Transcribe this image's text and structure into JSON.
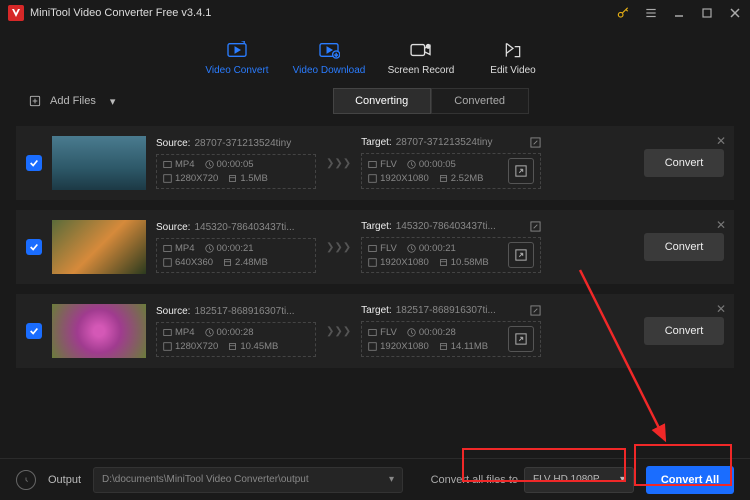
{
  "app": {
    "title": "MiniTool Video Converter Free v3.4.1"
  },
  "tabs": [
    {
      "label": "Video Convert"
    },
    {
      "label": "Video Download"
    },
    {
      "label": "Screen Record"
    },
    {
      "label": "Edit Video"
    }
  ],
  "addFiles": "Add Files",
  "subtabs": {
    "converting": "Converting",
    "converted": "Converted"
  },
  "labels": {
    "source": "Source:",
    "target": "Target:",
    "convert": "Convert"
  },
  "items": [
    {
      "source": {
        "name": "28707-371213524tiny",
        "fmt": "MP4",
        "dur": "00:00:05",
        "res": "1280X720",
        "size": "1.5MB"
      },
      "target": {
        "name": "28707-371213524tiny",
        "fmt": "FLV",
        "dur": "00:00:05",
        "res": "1920X1080",
        "size": "2.52MB"
      }
    },
    {
      "source": {
        "name": "145320-786403437ti...",
        "fmt": "MP4",
        "dur": "00:00:21",
        "res": "640X360",
        "size": "2.48MB"
      },
      "target": {
        "name": "145320-786403437ti...",
        "fmt": "FLV",
        "dur": "00:00:21",
        "res": "1920X1080",
        "size": "10.58MB"
      }
    },
    {
      "source": {
        "name": "182517-868916307ti...",
        "fmt": "MP4",
        "dur": "00:00:28",
        "res": "1280X720",
        "size": "10.45MB"
      },
      "target": {
        "name": "182517-868916307ti...",
        "fmt": "FLV",
        "dur": "00:00:28",
        "res": "1920X1080",
        "size": "14.11MB"
      }
    }
  ],
  "footer": {
    "output": "Output",
    "path": "D:\\documents\\MiniTool Video Converter\\output",
    "convertAllTo": "Convert all files to",
    "format": "FLV HD 1080P",
    "convertAll": "Convert All"
  }
}
